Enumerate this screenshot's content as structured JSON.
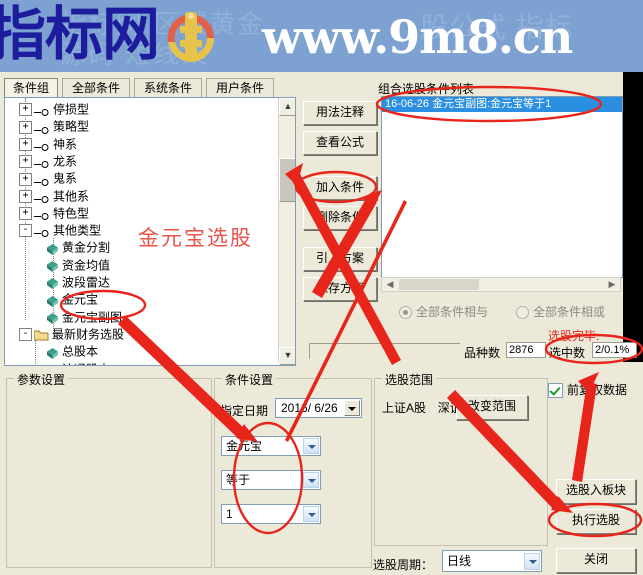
{
  "banner": {
    "title": "指标网",
    "url": "www.9m8.cn",
    "logo_text": "www.9m8.cn",
    "ghost_line1": "指标网 区域黄金",
    "ghost_line2": "源码 短线集",
    "ghost_line3": "股公式 指标",
    "bg_color": "#7da2d1",
    "title_color": "#1c1c9c"
  },
  "tabs": [
    {
      "label": "条件组",
      "selected": true
    },
    {
      "label": "全部条件",
      "selected": false
    },
    {
      "label": "系统条件",
      "selected": false
    },
    {
      "label": "用户条件",
      "selected": false
    }
  ],
  "tree": {
    "watermark": "金元宝选股",
    "watermark_color": "#e8534a",
    "nodes": [
      {
        "label": "停损型",
        "type": "group",
        "expander": "+",
        "indent": 0
      },
      {
        "label": "策略型",
        "type": "group",
        "expander": "+",
        "indent": 0
      },
      {
        "label": "神系",
        "type": "group",
        "expander": "+",
        "indent": 0
      },
      {
        "label": "龙系",
        "type": "group",
        "expander": "+",
        "indent": 0
      },
      {
        "label": "鬼系",
        "type": "group",
        "expander": "+",
        "indent": 0
      },
      {
        "label": "其他系",
        "type": "group",
        "expander": "+",
        "indent": 0
      },
      {
        "label": "特色型",
        "type": "group",
        "expander": "+",
        "indent": 0
      },
      {
        "label": "其他类型",
        "type": "group",
        "expander": "-",
        "indent": 0
      },
      {
        "label": "黄金分割",
        "type": "leaf",
        "expander": "",
        "indent": 1
      },
      {
        "label": "资金均值",
        "type": "leaf",
        "expander": "",
        "indent": 1
      },
      {
        "label": "波段雷达",
        "type": "leaf",
        "expander": "",
        "indent": 1
      },
      {
        "label": "金元宝",
        "type": "leaf",
        "expander": "",
        "indent": 1
      },
      {
        "label": "金元宝副图",
        "type": "leaf",
        "expander": "",
        "indent": 1,
        "circled": true
      },
      {
        "label": "最新财务选股",
        "type": "folder",
        "expander": "-",
        "indent": 0
      },
      {
        "label": "总股本",
        "type": "leaf",
        "expander": "",
        "indent": 1
      },
      {
        "label": "流通股本",
        "type": "leaf",
        "expander": "",
        "indent": 1
      }
    ]
  },
  "commands": [
    {
      "label": "用法注释",
      "name": "usage-note-button"
    },
    {
      "label": "查看公式",
      "name": "view-formula-button"
    },
    {
      "label": "加入条件",
      "name": "add-condition-button",
      "circled": true
    },
    {
      "label": "删除条件",
      "name": "delete-condition-button"
    },
    {
      "label": "引入方案",
      "name": "import-plan-button"
    },
    {
      "label": "保存方案",
      "name": "save-plan-button"
    }
  ],
  "condition_list": {
    "title": "组合选股条件列表",
    "items": [
      {
        "text": "16-06-26  金元宝副图:金元宝等于1",
        "selected": true
      }
    ]
  },
  "logic_options": [
    {
      "label": "全部条件相与",
      "checked": true
    },
    {
      "label": "全部条件相或",
      "checked": false
    }
  ],
  "status": {
    "done_text": "选股完毕.",
    "done_color": "#e02a1f",
    "variety_label": "品种数",
    "variety_value": "2876",
    "selected_label": "选中数",
    "selected_value": "2/0.1%"
  },
  "param_panel": {
    "legend": "参数设置"
  },
  "condition_panel": {
    "legend": "条件设置",
    "date_label": "指定日期",
    "date_value": "2016/ 6/26",
    "field_combo": "金元宝",
    "operator_combo": "等于",
    "value_combo": "1"
  },
  "range_panel": {
    "legend": "选股范围",
    "market1": "上证A股",
    "market2": "深证A股",
    "change_button": "改变范围",
    "cycle_label": "选股周期：",
    "cycle_value": "日线"
  },
  "right_controls": {
    "checkbox_label": "前复权数据",
    "checkbox_checked": true,
    "add_to_block_button": "选股入板块",
    "run_button": "执行选股",
    "close_button": "关闭"
  }
}
